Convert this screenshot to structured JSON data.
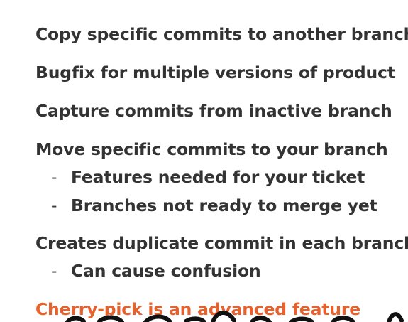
{
  "slide": {
    "bullets": [
      {
        "text": "Copy specific commits to another branch"
      },
      {
        "text": "Bugfix for multiple versions of product"
      },
      {
        "text": "Capture commits from inactive branch"
      },
      {
        "text": "Move specific commits to your branch"
      }
    ],
    "move_subitems": [
      {
        "dash": "-",
        "text": "Features needed for your ticket"
      },
      {
        "dash": "-",
        "text": "Branches not ready to merge yet"
      }
    ],
    "duplicate": {
      "text": "Creates duplicate commit in each branch"
    },
    "duplicate_subitems": [
      {
        "dash": "-",
        "text": "Can cause confusion"
      }
    ],
    "warning": {
      "text": "Cherry-pick is an advanced feature"
    }
  },
  "colors": {
    "text": "#333333",
    "accent": "#e8602c",
    "handwriting": "#111111"
  }
}
